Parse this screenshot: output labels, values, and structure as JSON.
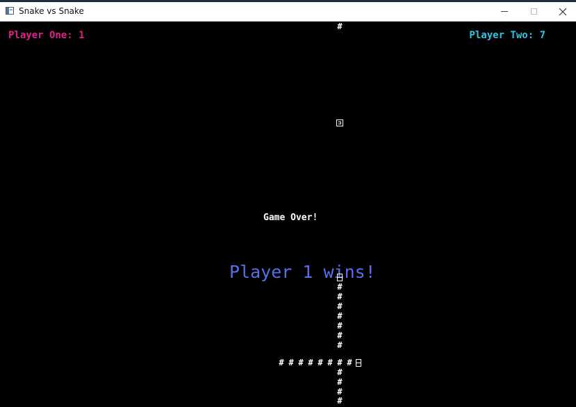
{
  "window": {
    "title": "Snake vs Snake"
  },
  "score": {
    "player_one": "Player One: 1",
    "player_two": "Player Two: 7"
  },
  "messages": {
    "game_over": "Game Over!",
    "winner": "Player 1 wins!"
  },
  "board": {
    "segment_char": "#",
    "background": "#000000"
  },
  "colors": {
    "player_one": "#e0208e",
    "player_two": "#2cc6e6",
    "winner_text": "#5a6ee8"
  }
}
